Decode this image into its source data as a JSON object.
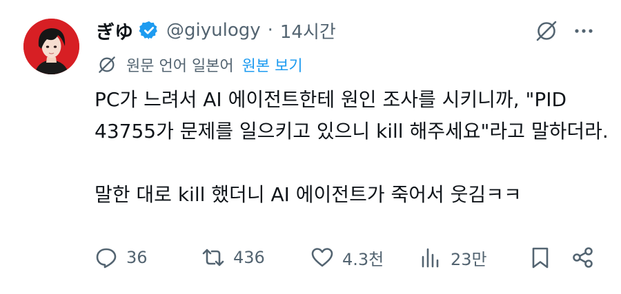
{
  "author": {
    "display_name": "ぎゆ",
    "handle": "@giyulogy",
    "separator": "·",
    "time_ago": "14시간",
    "avatar_bg": "#d71f24"
  },
  "translation": {
    "note": "원문 언어 일본어",
    "show_original": "원본 보기"
  },
  "tweet": {
    "paragraph1": "PC가 느려서 AI 에이전트한테 원인 조사를 시키니까, \"PID 43755가 문제를 일으키고 있으니 kill 해주세요\"라고 말하더라.",
    "paragraph2": "말한 대로 kill 했더니 AI 에이전트가 죽어서 웃김ㅋㅋ"
  },
  "actions": {
    "replies": "36",
    "retweets": "436",
    "likes": "4.3천",
    "views": "23만"
  },
  "colors": {
    "text": "#0f1419",
    "secondary": "#536471",
    "link": "#1d9bf0",
    "verified": "#1d9bf0"
  },
  "icons": [
    "grok-icon",
    "more-icon",
    "verified-badge-icon",
    "reply-icon",
    "retweet-icon",
    "like-icon",
    "views-icon",
    "bookmark-icon",
    "share-icon"
  ]
}
